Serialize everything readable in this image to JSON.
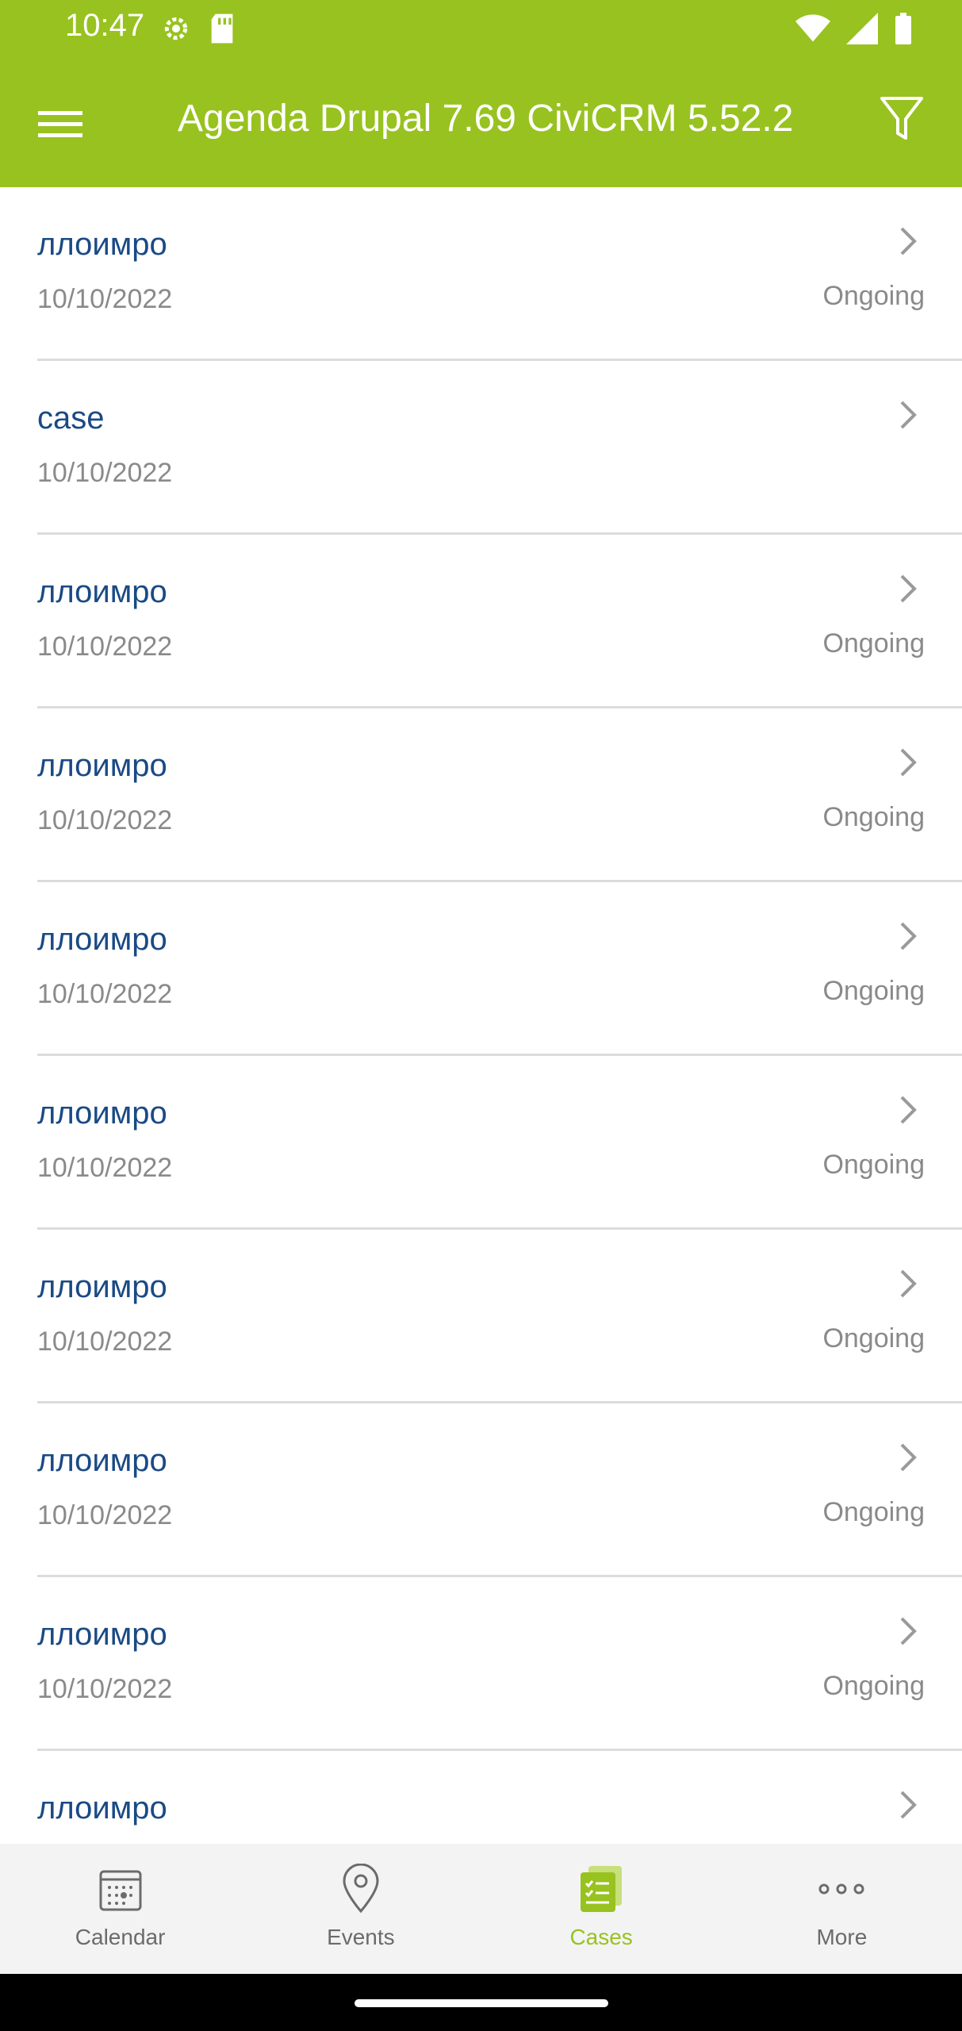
{
  "status_bar": {
    "time": "10:47",
    "icons": [
      "settings-icon",
      "sd-card-icon",
      "wifi-icon",
      "signal-icon",
      "battery-icon"
    ]
  },
  "app_bar": {
    "title": "Agenda Drupal 7.69 CiviCRM 5.52.2",
    "menu_icon": "hamburger-menu-icon",
    "filter_icon": "filter-icon",
    "color": "#98c21f"
  },
  "cases": [
    {
      "title": "ллоимро",
      "date": "10/10/2022",
      "status": "Ongoing"
    },
    {
      "title": "case",
      "date": "10/10/2022",
      "status": ""
    },
    {
      "title": "ллоимро",
      "date": "10/10/2022",
      "status": "Ongoing"
    },
    {
      "title": "ллоимро",
      "date": "10/10/2022",
      "status": "Ongoing"
    },
    {
      "title": "ллоимро",
      "date": "10/10/2022",
      "status": "Ongoing"
    },
    {
      "title": "ллоимро",
      "date": "10/10/2022",
      "status": "Ongoing"
    },
    {
      "title": "ллоимро",
      "date": "10/10/2022",
      "status": "Ongoing"
    },
    {
      "title": "ллоимро",
      "date": "10/10/2022",
      "status": "Ongoing"
    },
    {
      "title": "ллоимро",
      "date": "10/10/2022",
      "status": "Ongoing"
    },
    {
      "title": "ллоимро",
      "date": "",
      "status": ""
    }
  ],
  "bottom_nav": {
    "items": [
      {
        "label": "Calendar",
        "icon": "calendar-icon",
        "active": false
      },
      {
        "label": "Events",
        "icon": "location-pin-icon",
        "active": false
      },
      {
        "label": "Cases",
        "icon": "cases-checklist-icon",
        "active": true
      },
      {
        "label": "More",
        "icon": "more-dots-icon",
        "active": false
      }
    ]
  },
  "colors": {
    "accent": "#98c21f",
    "link": "#1a4a85",
    "muted": "#8a8a8a"
  }
}
